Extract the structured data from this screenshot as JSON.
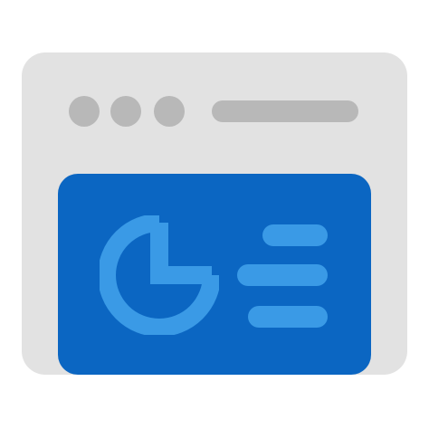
{
  "icon": {
    "name": "web-dashboard-icon",
    "colors": {
      "window": "#e2e2e2",
      "window_controls": "#b8b8b8",
      "card": "#0b66c2",
      "card_details": "#3a9ae6"
    }
  }
}
